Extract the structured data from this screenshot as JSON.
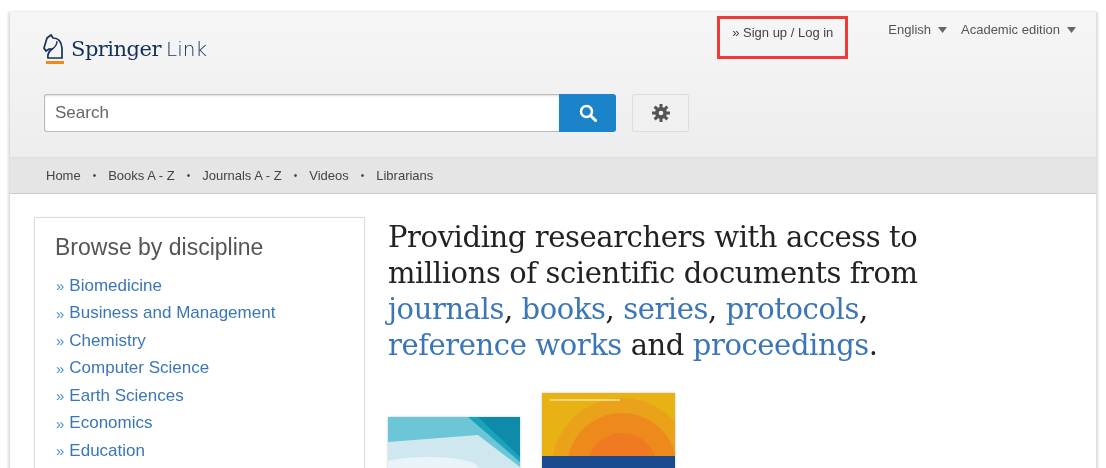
{
  "header": {
    "logo": {
      "brand": "Springer",
      "product": "Link"
    },
    "signin": {
      "label": "» Sign up / Log in",
      "highlighted": true
    },
    "menus": [
      {
        "label": "English"
      },
      {
        "label": "Academic edition"
      }
    ],
    "search": {
      "placeholder": "Search"
    },
    "nav": {
      "separator": "•",
      "items": [
        "Home",
        "Books A - Z",
        "Journals A - Z",
        "Videos",
        "Librarians"
      ]
    }
  },
  "sidebar": {
    "title": "Browse by discipline",
    "bullet": "»",
    "items": [
      "Biomedicine",
      "Business and Management",
      "Chemistry",
      "Computer Science",
      "Earth Sciences",
      "Economics",
      "Education"
    ]
  },
  "hero": {
    "segments": [
      {
        "text": "Providing researchers with access to millions of scientific documents from ",
        "link": false
      },
      {
        "text": "journals",
        "link": true
      },
      {
        "text": ", ",
        "link": false
      },
      {
        "text": "books",
        "link": true
      },
      {
        "text": ", ",
        "link": false
      },
      {
        "text": "series",
        "link": true
      },
      {
        "text": ", ",
        "link": false
      },
      {
        "text": "protocols",
        "link": true
      },
      {
        "text": ", ",
        "link": false
      },
      {
        "text": "reference works",
        "link": true
      },
      {
        "text": " and ",
        "link": false
      },
      {
        "text": "proceedings",
        "link": true
      },
      {
        "text": ".",
        "link": false
      }
    ]
  }
}
